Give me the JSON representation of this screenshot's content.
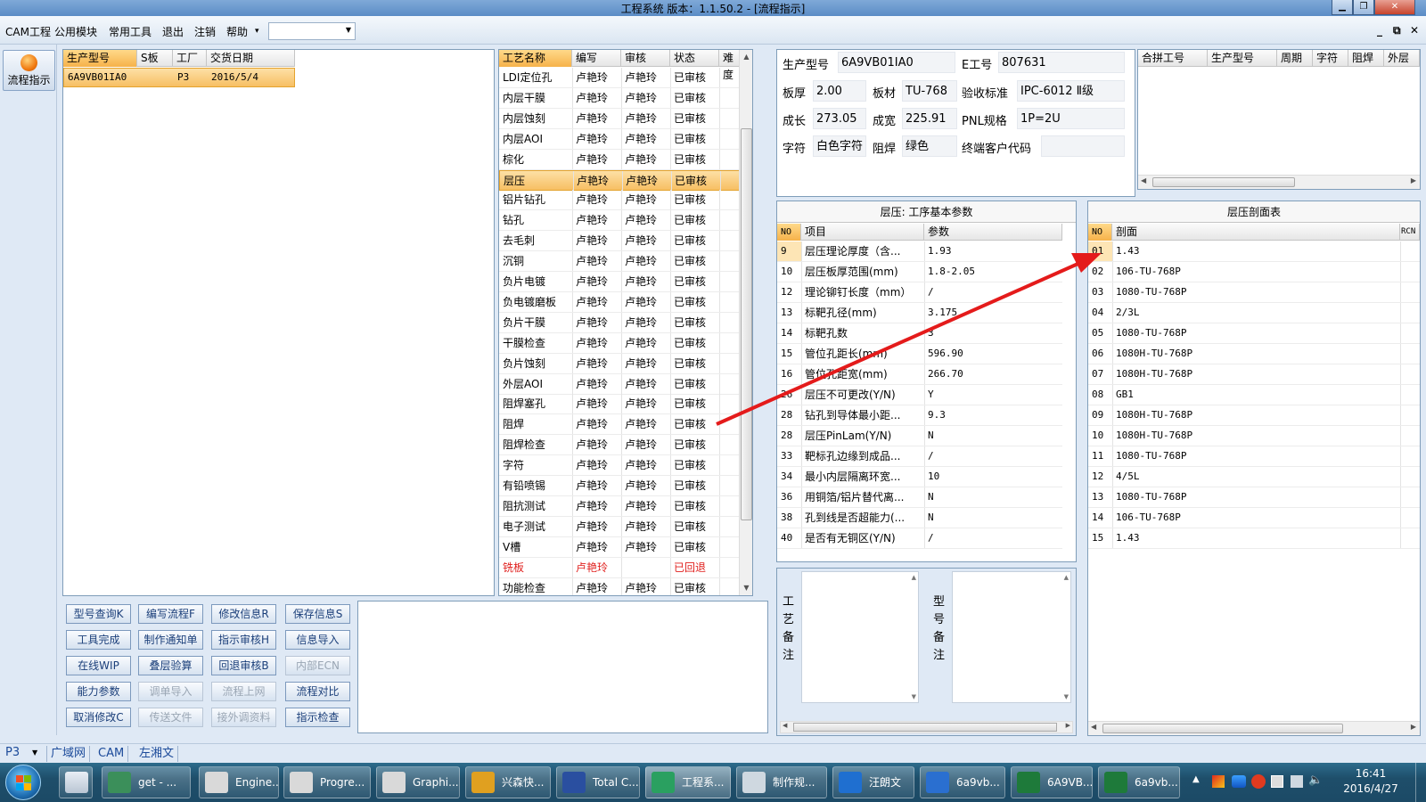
{
  "window": {
    "title": "工程系统   版本：1.1.50.2 - [流程指示]"
  },
  "menu": {
    "items": [
      "CAM工程",
      "公用模块",
      "常用工具",
      "退出",
      "注销",
      "帮助"
    ],
    "help_arrow": "▾"
  },
  "left_nav": {
    "flow_button": "流程指示"
  },
  "order_table": {
    "headers": [
      "生产型号",
      "S板",
      "工厂",
      "交货日期"
    ],
    "rows": [
      [
        "6A9VB01IA0",
        "",
        "P3",
        "2016/5/4"
      ]
    ]
  },
  "process_table": {
    "headers": [
      "工艺名称",
      "编写",
      "审核",
      "状态",
      "难度"
    ],
    "rows": [
      [
        "LDI定位孔",
        "卢艳玲",
        "卢艳玲",
        "已审核",
        ""
      ],
      [
        "内层干膜",
        "卢艳玲",
        "卢艳玲",
        "已审核",
        ""
      ],
      [
        "内层蚀刻",
        "卢艳玲",
        "卢艳玲",
        "已审核",
        ""
      ],
      [
        "内层AOI",
        "卢艳玲",
        "卢艳玲",
        "已审核",
        ""
      ],
      [
        "棕化",
        "卢艳玲",
        "卢艳玲",
        "已审核",
        ""
      ],
      [
        "层压",
        "卢艳玲",
        "卢艳玲",
        "已审核",
        ""
      ],
      [
        "铝片钻孔",
        "卢艳玲",
        "卢艳玲",
        "已审核",
        ""
      ],
      [
        "钻孔",
        "卢艳玲",
        "卢艳玲",
        "已审核",
        ""
      ],
      [
        "去毛刺",
        "卢艳玲",
        "卢艳玲",
        "已审核",
        ""
      ],
      [
        "沉铜",
        "卢艳玲",
        "卢艳玲",
        "已审核",
        ""
      ],
      [
        "负片电镀",
        "卢艳玲",
        "卢艳玲",
        "已审核",
        ""
      ],
      [
        "负电镀磨板",
        "卢艳玲",
        "卢艳玲",
        "已审核",
        ""
      ],
      [
        "负片干膜",
        "卢艳玲",
        "卢艳玲",
        "已审核",
        ""
      ],
      [
        "干膜检查",
        "卢艳玲",
        "卢艳玲",
        "已审核",
        ""
      ],
      [
        "负片蚀刻",
        "卢艳玲",
        "卢艳玲",
        "已审核",
        ""
      ],
      [
        "外层AOI",
        "卢艳玲",
        "卢艳玲",
        "已审核",
        ""
      ],
      [
        "阻焊塞孔",
        "卢艳玲",
        "卢艳玲",
        "已审核",
        ""
      ],
      [
        "阻焊",
        "卢艳玲",
        "卢艳玲",
        "已审核",
        ""
      ],
      [
        "阻焊检查",
        "卢艳玲",
        "卢艳玲",
        "已审核",
        ""
      ],
      [
        "字符",
        "卢艳玲",
        "卢艳玲",
        "已审核",
        ""
      ],
      [
        "有铅喷锡",
        "卢艳玲",
        "卢艳玲",
        "已审核",
        ""
      ],
      [
        "阻抗测试",
        "卢艳玲",
        "卢艳玲",
        "已审核",
        ""
      ],
      [
        "电子测试",
        "卢艳玲",
        "卢艳玲",
        "已审核",
        ""
      ],
      [
        "V槽",
        "卢艳玲",
        "卢艳玲",
        "已审核",
        ""
      ],
      [
        "铣板",
        "卢艳玲",
        "",
        "已回退",
        ""
      ],
      [
        "功能检查",
        "卢艳玲",
        "卢艳玲",
        "已审核",
        ""
      ]
    ],
    "selected_index": 5,
    "returned_index": 24,
    "returned_color": "#e0201e"
  },
  "buttons": [
    [
      "型号查询K",
      "编写流程F",
      "修改信息R",
      "保存信息S"
    ],
    [
      "工具完成",
      "制作通知单",
      "指示审核H",
      "信息导入"
    ],
    [
      "在线WIP",
      "叠层验算",
      "回退审核B",
      "内部ECN"
    ],
    [
      "能力参数",
      "调单导入",
      "流程上网",
      "流程对比"
    ],
    [
      "取消修改C",
      "传送文件",
      "接外调资料",
      "指示检查"
    ]
  ],
  "disabled_buttons": [
    "内部ECN",
    "调单导入",
    "流程上网",
    "传送文件",
    "接外调资料"
  ],
  "info": {
    "prod_model_label": "生产型号",
    "prod_model": "6A9VB01IA0",
    "e_no_label": "E工号",
    "e_no": "807631",
    "thickness_label": "板厚",
    "thickness": "2.00",
    "material_label": "板材",
    "material": "TU-768",
    "standard_label": "验收标准",
    "standard": "IPC-6012 Ⅱ级",
    "length_label": "成长",
    "length": "273.05",
    "width_label": "成宽",
    "width": "225.91",
    "pnl_label": "PNL规格",
    "pnl": "1P=2U",
    "char_label": "字符",
    "char": "白色字符",
    "mask_label": "阻焊",
    "mask": "绿色",
    "customer_label": "终端客户代码",
    "customer": ""
  },
  "merge_table": {
    "headers": [
      "合拼工号",
      "生产型号",
      "周期",
      "字符",
      "阻焊",
      "外层"
    ]
  },
  "params": {
    "title": "层压: 工序基本参数",
    "headers": [
      "NO",
      "项目",
      "参数"
    ],
    "rows": [
      [
        "9",
        "层压理论厚度（含...",
        "1.93"
      ],
      [
        "10",
        "层压板厚范围(mm)",
        "1.8-2.05"
      ],
      [
        "12",
        "理论铆钉长度（mm）",
        "/"
      ],
      [
        "13",
        "标靶孔径(mm)",
        "3.175"
      ],
      [
        "14",
        "标靶孔数",
        "3"
      ],
      [
        "15",
        "管位孔距长(mm)",
        "596.90"
      ],
      [
        "16",
        "管位孔距宽(mm)",
        "266.70"
      ],
      [
        "26",
        "层压不可更改(Y/N)",
        "Y"
      ],
      [
        "28",
        "钻孔到导体最小距...",
        "9.3"
      ],
      [
        "28",
        "层压PinLam(Y/N)",
        "N"
      ],
      [
        "33",
        "靶标孔边缘到成品...",
        "/"
      ],
      [
        "34",
        "最小内层隔离环宽...",
        "10"
      ],
      [
        "36",
        "用铜箔/铝片替代离...",
        "N"
      ],
      [
        "38",
        "孔到线是否超能力(...",
        "N"
      ],
      [
        "40",
        "是否有无铜区(Y/N)",
        "/"
      ]
    ]
  },
  "stackup": {
    "title": "层压剖面表",
    "headers": [
      "NO",
      "剖面",
      "RCN"
    ],
    "rows": [
      [
        "01",
        "1.43"
      ],
      [
        "02",
        "106-TU-768P"
      ],
      [
        "03",
        "1080-TU-768P"
      ],
      [
        "04",
        "2/3L"
      ],
      [
        "05",
        "1080-TU-768P"
      ],
      [
        "06",
        "1080H-TU-768P"
      ],
      [
        "07",
        "1080H-TU-768P"
      ],
      [
        "08",
        "GB1"
      ],
      [
        "09",
        "1080H-TU-768P"
      ],
      [
        "10",
        "1080H-TU-768P"
      ],
      [
        "11",
        "1080-TU-768P"
      ],
      [
        "12",
        "4/5L"
      ],
      [
        "13",
        "1080-TU-768P"
      ],
      [
        "14",
        "106-TU-768P"
      ],
      [
        "15",
        "1.43"
      ]
    ]
  },
  "remarks": {
    "process_label": "工艺备注",
    "model_label": "型号备注"
  },
  "statusbar": {
    "factory": "P3",
    "tabs": [
      "广域网",
      "CAM",
      "左湘文"
    ]
  },
  "taskbar": {
    "items": [
      "get - ...",
      "Engine...",
      "Progre...",
      "Graphi...",
      "兴森快...",
      "Total C...",
      "工程系...",
      "制作规...",
      "汪朗文",
      "6a9vb...",
      "6A9VB...",
      "6a9vb..."
    ],
    "clock_time": "16:41",
    "clock_date": "2016/4/27"
  },
  "annotation": {
    "arrow_color": "#e41b1b"
  }
}
